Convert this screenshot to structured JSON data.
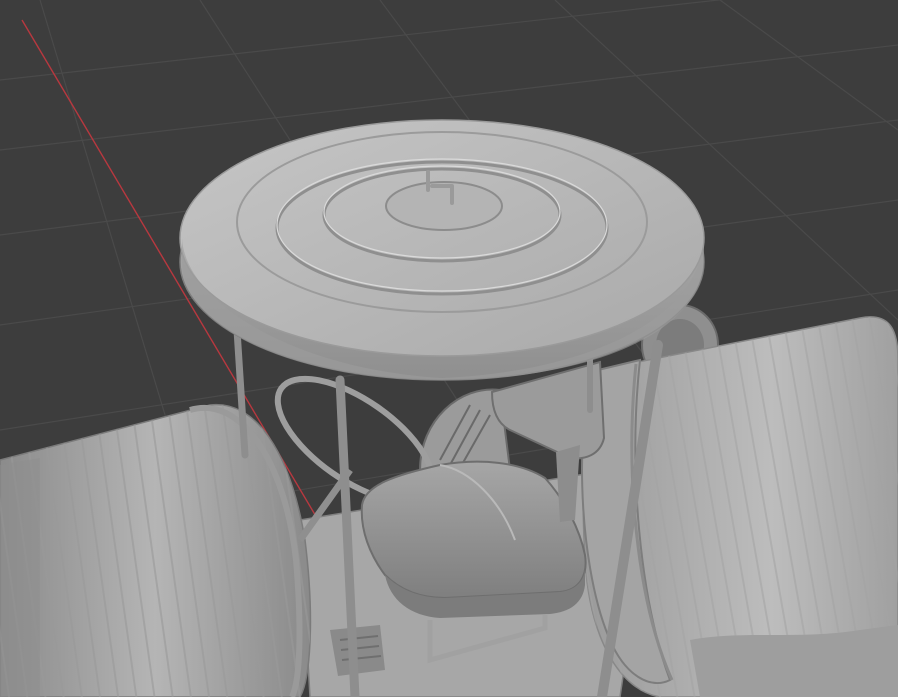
{
  "viewport": {
    "background": "#3d3d3d",
    "grid_color": "#4a4a4a",
    "x_axis_color": "#b8383f",
    "model_color": "#b4b4b4",
    "model_shadow": "#777777",
    "shading": "solid"
  },
  "scene": {
    "object": "trash-can-tractor",
    "parts": [
      "lid-roof",
      "lid-handle",
      "canopy-pole",
      "steering-wheel",
      "seat",
      "left-trash-can-wheel",
      "right-trash-can-wheel",
      "engine-block",
      "footrest-bracket"
    ]
  }
}
